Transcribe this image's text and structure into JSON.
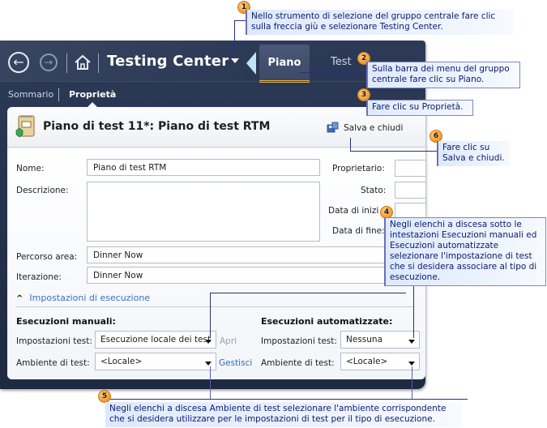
{
  "app": {
    "title": "Testing Center",
    "nav": {
      "back_icon": "back-arrow-circle-icon",
      "forward_icon": "forward-arrow-circle-icon",
      "home_icon": "home-icon",
      "group_dropdown_icon": "chevron-down-icon"
    },
    "tabs": [
      {
        "label": "Piano",
        "selected": true
      },
      {
        "label": "Test",
        "selected": false
      }
    ],
    "subnav": [
      {
        "label": "Sommario",
        "selected": false
      },
      {
        "label": "Proprietà",
        "selected": true
      }
    ],
    "accent_color": "#e0b44a"
  },
  "panel": {
    "title": "Piano di test 11*: Piano di test RTM",
    "save_close_label": "Salva e chiudi",
    "fields": {
      "nome": {
        "label": "Nome:",
        "value": "Piano di test RTM"
      },
      "descrizione": {
        "label": "Descrizione:",
        "value": ""
      },
      "proprietario": {
        "label": "Proprietario:",
        "value": ""
      },
      "stato": {
        "label": "Stato:",
        "value": ""
      },
      "data_inizio": {
        "label": "Data di inizi",
        "value": ""
      },
      "data_fine": {
        "label": "Data di fine:",
        "value": ""
      },
      "percorso_area": {
        "label": "Percorso area:",
        "value": "Dinner Now"
      },
      "iterazione": {
        "label": "Iterazione:",
        "value": "Dinner Now"
      }
    },
    "run_settings": {
      "section_label": "Impostazioni di esecuzione",
      "manual": {
        "heading": "Esecuzioni manuali:",
        "test_settings_label": "Impostazioni test:",
        "test_settings_value": "Esecuzione locale dei test",
        "open_link": "Apri",
        "environment_label": "Ambiente di test:",
        "environment_value": "<Locale>",
        "manage_link": "Gestisci"
      },
      "automated": {
        "heading": "Esecuzioni automatizzate:",
        "test_settings_label": "Impostazioni test:",
        "test_settings_value": "Nessuna",
        "environment_label": "Ambiente di test:",
        "environment_value": "<Locale>"
      }
    }
  },
  "callouts": [
    {
      "number": "1",
      "text": "Nello strumento di selezione del gruppo centrale fare clic sulla freccia giù e selezionare Testing Center."
    },
    {
      "number": "2",
      "text": "Sulla barra dei menu del gruppo centrale fare clic su Piano."
    },
    {
      "number": "3",
      "text": "Fare clic su Proprietà."
    },
    {
      "number": "4",
      "text": "Negli elenchi a discesa sotto le intestazioni Esecuzioni manuali ed Esecuzioni automatizzate selezionare l'impostazione di test che si desidera associare al tipo di esecuzione."
    },
    {
      "number": "5",
      "text": "Negli elenchi a discesa Ambiente di test selezionare l'ambiente corrispondente che si desidera utilizzare per le impostazioni di test per il tipo di esecuzione."
    },
    {
      "number": "6",
      "text": "Fare clic su Salva e chiudi."
    }
  ]
}
